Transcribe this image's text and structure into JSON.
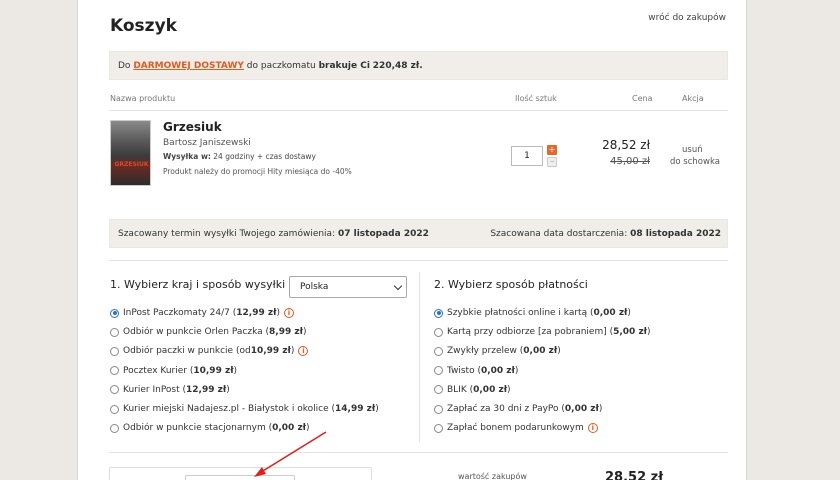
{
  "header": {
    "title": "Koszyk",
    "back_link": "wróć do zakupów"
  },
  "banner": {
    "prefix": "Do",
    "promo_link": "DARMOWEJ DOSTAWY",
    "middle": "do paczkomatu",
    "missing_label": "brakuje Ci",
    "missing_amount": "220,48 zł."
  },
  "table": {
    "col_product": "Nazwa produktu",
    "col_qty": "Ilość sztuk",
    "col_price": "Cena",
    "col_action": "Akcja"
  },
  "product": {
    "title": "Grzesiuk",
    "author": "Bartosz Janiszewski",
    "shipping_label": "Wysyłka w:",
    "shipping_value": "24 godziny + czas dostawy",
    "promo_note": "Produkt należy do promocji Hity miesiąca do -40%",
    "cover_text": "GRZESIUK",
    "qty": "1",
    "price": "28,52 zł",
    "old_price": "45,00 zł",
    "remove": "usuń",
    "to_box": "do schowka"
  },
  "info": {
    "ship_label": "Szacowany termin wysyłki Twojego zamówienia:",
    "ship_date": "07 listopada 2022",
    "delivery_label": "Szacowana data dostarczenia:",
    "delivery_date": "08 listopada 2022"
  },
  "shipping": {
    "title": "1. Wybierz kraj i sposób wysyłki",
    "country": "Polska",
    "options": [
      {
        "label": "InPost Paczkomaty 24/7 (",
        "price": "12,99 zł",
        "suffix": ")",
        "selected": true,
        "info": true
      },
      {
        "label": "Odbiór w punkcie Orlen Paczka (",
        "price": "8,99 zł",
        "suffix": ")",
        "selected": false,
        "info": false
      },
      {
        "label": "Odbiór paczki w punkcie (od ",
        "price": "10,99 zł",
        "suffix": ")",
        "selected": false,
        "info": true
      },
      {
        "label": "Pocztex Kurier (",
        "price": "10,99 zł",
        "suffix": ")",
        "selected": false,
        "info": false
      },
      {
        "label": "Kurier InPost (",
        "price": "12,99 zł",
        "suffix": ")",
        "selected": false,
        "info": false
      },
      {
        "label": "Kurier miejski Nadajesz.pl - Białystok i okolice (",
        "price": "14,99 zł",
        "suffix": ")",
        "selected": false,
        "info": false
      },
      {
        "label": "Odbiór w punkcie stacjonarnym (",
        "price": "0,00 zł",
        "suffix": ")",
        "selected": false,
        "info": false
      }
    ]
  },
  "payment": {
    "title": "2. Wybierz sposób płatności",
    "options": [
      {
        "label": "Szybkie płatności online i kartą (",
        "price": "0,00 zł",
        "suffix": ")",
        "selected": true,
        "info": false
      },
      {
        "label": "Kartą przy odbiorze [za pobraniem] (",
        "price": "5,00 zł",
        "suffix": ")",
        "selected": false,
        "info": false
      },
      {
        "label": "Zwykły przelew (",
        "price": "0,00 zł",
        "suffix": ")",
        "selected": false,
        "info": false
      },
      {
        "label": "Twisto (",
        "price": "0,00 zł",
        "suffix": ")",
        "selected": false,
        "info": false
      },
      {
        "label": "BLIK (",
        "price": "0,00 zł",
        "suffix": ")",
        "selected": false,
        "info": false
      },
      {
        "label": "Zapłać za 30 dni z PayPo (",
        "price": "0,00 zł",
        "suffix": ")",
        "selected": false,
        "info": false
      },
      {
        "label": "Zapłać bonem podarunkowym",
        "price": "",
        "suffix": "",
        "selected": false,
        "info": true
      }
    ]
  },
  "summary": {
    "label": "wartość zakupów",
    "value": "28,52 zł"
  },
  "colors": {
    "accent": "#e05a24",
    "radio": "#2a6fd6",
    "banner_bg": "#f1eeea",
    "page_bg": "#ece9e4"
  },
  "icons": {
    "info": "info-icon",
    "arrow": "red-annotation-arrow"
  }
}
